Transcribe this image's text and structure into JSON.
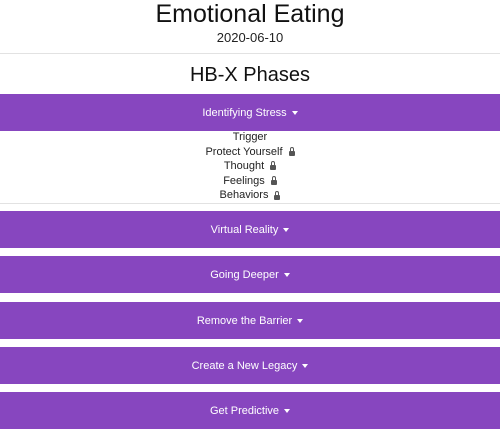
{
  "header": {
    "title": "Emotional Eating",
    "date": "2020-06-10",
    "section_title": "HB-X Phases"
  },
  "colors": {
    "accent": "#8746BF",
    "lock": "#555555"
  },
  "phases": [
    {
      "label": "Identifying Stress",
      "expanded": true,
      "items": [
        {
          "label": "Trigger",
          "locked": false
        },
        {
          "label": "Protect Yourself",
          "locked": true
        },
        {
          "label": "Thought",
          "locked": true
        },
        {
          "label": "Feelings",
          "locked": true
        },
        {
          "label": "Behaviors",
          "locked": true
        }
      ]
    },
    {
      "label": "Virtual Reality",
      "expanded": false
    },
    {
      "label": "Going Deeper",
      "expanded": false
    },
    {
      "label": "Remove the Barrier",
      "expanded": false
    },
    {
      "label": "Create a New Legacy",
      "expanded": false
    },
    {
      "label": "Get Predictive",
      "expanded": false
    }
  ]
}
